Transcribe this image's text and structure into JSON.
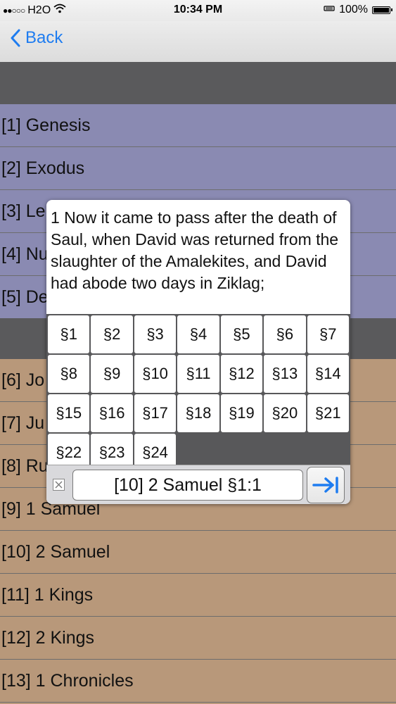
{
  "status_bar": {
    "signal": "●●○○○",
    "carrier": "H2O",
    "time": "10:34 PM",
    "battery": "100%",
    "icons": [
      "wifi-icon",
      "alarm-icon",
      "battery-icon"
    ]
  },
  "nav": {
    "back_label": "Back"
  },
  "books_top": [
    "[1] Genesis",
    "[2] Exodus",
    "[3] Le",
    "[4] Nu",
    "[5] De"
  ],
  "books_bottom": [
    "[6] Jo",
    "[7] Ju",
    "[8] Ru",
    "[9] 1 Samuel",
    "[10] 2 Samuel",
    "[11] 1 Kings",
    "[12] 2 Kings",
    "[13] 1 Chronicles"
  ],
  "popup": {
    "verse_text": "1 Now it came to pass after the death of Saul, when David was returned from the slaughter of the Amalekites, and David had abode two days in Ziklag;",
    "sections": [
      "§1",
      "§2",
      "§3",
      "§4",
      "§5",
      "§6",
      "§7",
      "§8",
      "§9",
      "§10",
      "§11",
      "§12",
      "§13",
      "§14",
      "§15",
      "§16",
      "§17",
      "§18",
      "§19",
      "§20",
      "§21",
      "§22",
      "§23",
      "§24"
    ],
    "reference_value": "[10] 2 Samuel §1:1",
    "go_icon": "arrow-right-to-bar-icon",
    "clear_icon": "clear-box-icon"
  },
  "colors": {
    "accent": "#1e7cf0",
    "top_list_bg": "#8a8ab2",
    "bottom_list_bg": "#b8987a",
    "header_band": "#5a5a5c"
  }
}
